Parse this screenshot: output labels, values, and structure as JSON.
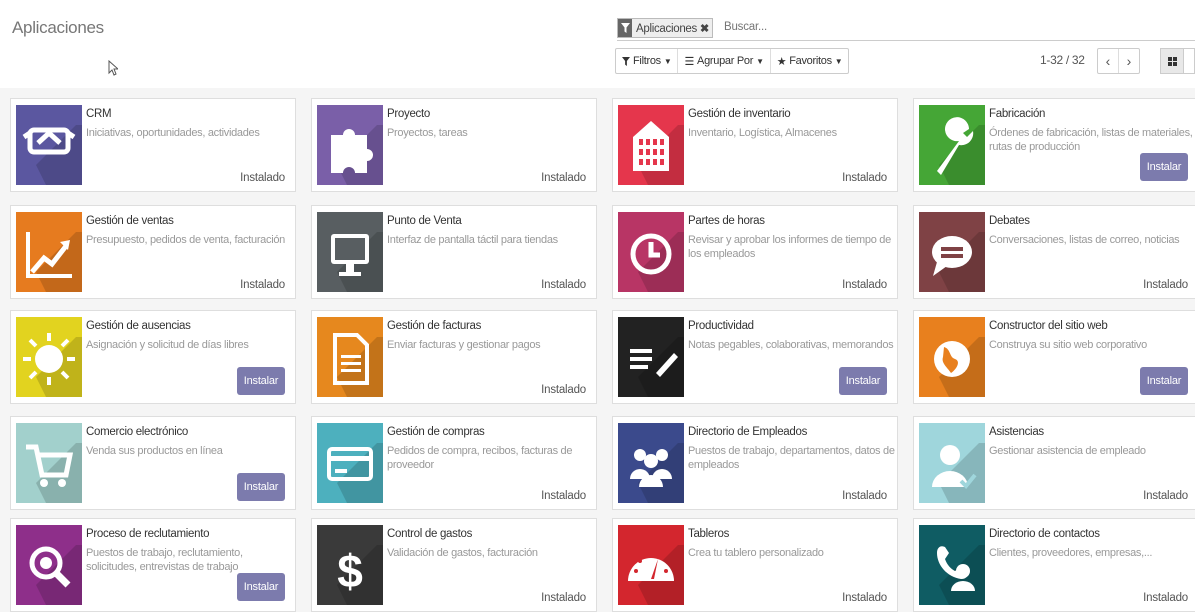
{
  "header": {
    "title": "Aplicaciones",
    "facet_label": "Aplicaciones",
    "search_placeholder": "Buscar...",
    "filters_label": "Filtros",
    "groupby_label": "Agrupar Por",
    "favorites_label": "Favoritos",
    "pager": "1-32 / 32",
    "prev_icon": "chevron-left-icon",
    "next_icon": "chevron-right-icon"
  },
  "apps": [
    {
      "name": "CRM",
      "desc": "Iniciativas, oportunidades, actividades",
      "status": "Instalado",
      "icon": "handshake-icon",
      "color": "#5b57a0"
    },
    {
      "name": "Proyecto",
      "desc": "Proyectos, tareas",
      "status": "Instalado",
      "icon": "puzzle-icon",
      "color": "#7a5fa8"
    },
    {
      "name": "Gestión de inventario",
      "desc": "Inventario, Logística, Almacenes",
      "status": "Instalado",
      "icon": "building-icon",
      "color": "#e5364c"
    },
    {
      "name": "Fabricación",
      "desc": "Órdenes de fabricación, listas de materiales, rutas de producción",
      "status": "Instalar",
      "icon": "wrench-icon",
      "color": "#45a636"
    },
    {
      "name": "Gestión de ventas",
      "desc": "Presupuesto, pedidos de venta, facturación",
      "status": "Instalado",
      "icon": "chart-up-icon",
      "color": "#e67b1f"
    },
    {
      "name": "Punto de Venta",
      "desc": "Interfaz de pantalla táctil para tiendas",
      "status": "Instalado",
      "icon": "monitor-icon",
      "color": "#585e61"
    },
    {
      "name": "Partes de horas",
      "desc": "Revisar y aprobar los informes de tiempo de los empleados",
      "status": "Instalado",
      "icon": "clock-icon",
      "color": "#b83565"
    },
    {
      "name": "Debates",
      "desc": "Conversaciones, listas de correo, noticias",
      "status": "Instalado",
      "icon": "chat-icon",
      "color": "#7f4245"
    },
    {
      "name": "Gestión de ausencias",
      "desc": "Asignación y solicitud de días libres",
      "status": "Instalar",
      "icon": "sun-icon",
      "color": "#e2d31f"
    },
    {
      "name": "Gestión de facturas",
      "desc": "Enviar facturas y gestionar pagos",
      "status": "Instalado",
      "icon": "document-icon",
      "color": "#e6881e"
    },
    {
      "name": "Productividad",
      "desc": "Notas pegables, colaborativas, memorandos",
      "status": "Instalar",
      "icon": "notes-icon",
      "color": "#222222"
    },
    {
      "name": "Constructor del sitio web",
      "desc": "Construya su sitio web corporativo",
      "status": "Instalar",
      "icon": "globe-icon",
      "color": "#e8801e"
    },
    {
      "name": "Comercio electrónico",
      "desc": "Venda sus productos en línea",
      "status": "Instalar",
      "icon": "cart-icon",
      "color": "#a2d0cc"
    },
    {
      "name": "Gestión de compras",
      "desc": "Pedidos de compra, recibos, facturas de proveedor",
      "status": "Instalado",
      "icon": "credit-card-icon",
      "color": "#4db0be"
    },
    {
      "name": "Directorio de Empleados",
      "desc": "Puestos de trabajo, departamentos, datos de empleados",
      "status": "Instalado",
      "icon": "people-icon",
      "color": "#3b4a8c"
    },
    {
      "name": "Asistencias",
      "desc": "Gestionar asistencia de empleado",
      "status": "Instalado",
      "icon": "user-check-icon",
      "color": "#9fd6dc"
    },
    {
      "name": "Proceso de reclutamiento",
      "desc": "Puestos de trabajo, reclutamiento, solicitudes, entrevistas de trabajo",
      "status": "Instalar",
      "icon": "search-icon",
      "color": "#8e2f8a"
    },
    {
      "name": "Control de gastos",
      "desc": "Validación de gastos, facturación",
      "status": "Instalado",
      "icon": "dollar-icon",
      "color": "#3a3a3a"
    },
    {
      "name": "Tableros",
      "desc": "Crea tu tablero personalizado",
      "status": "Instalado",
      "icon": "gauge-icon",
      "color": "#d3262e"
    },
    {
      "name": "Directorio de contactos",
      "desc": "Clientes, proveedores, empresas,...",
      "status": "Instalado",
      "icon": "phone-contact-icon",
      "color": "#0f5c63"
    }
  ]
}
